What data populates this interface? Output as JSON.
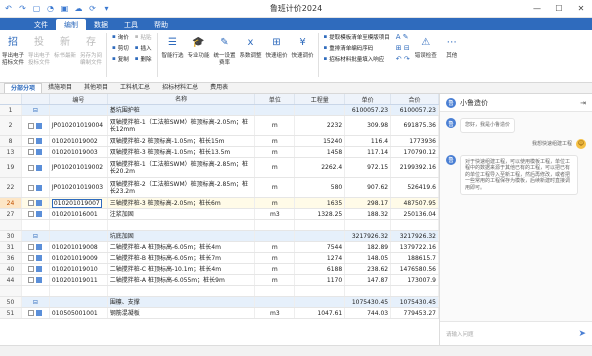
{
  "app": {
    "title": "鲁班计价2024"
  },
  "menu": [
    "文件",
    "编制",
    "数据",
    "工具",
    "帮助"
  ],
  "ribbon": {
    "buttons1": [
      {
        "label": "导出电子招标文件",
        "icon": "招",
        "dim": false
      },
      {
        "label": "导出电子投标文件",
        "icon": "投",
        "dim": true
      },
      {
        "label": "标书最新",
        "icon": "新",
        "dim": true
      },
      {
        "label": "另存为间编制文件",
        "icon": "存",
        "dim": true
      }
    ],
    "small1": [
      {
        "label": "询价",
        "dim": false
      },
      {
        "label": "剪切",
        "dim": false
      },
      {
        "label": "复制",
        "dim": false
      }
    ],
    "small2": [
      {
        "label": "粘贴",
        "dim": true
      },
      {
        "label": "插入",
        "dim": false
      },
      {
        "label": "删除",
        "dim": false
      }
    ],
    "buttons2": [
      {
        "label": "智能行选",
        "icon": "☰"
      },
      {
        "label": "专业功能",
        "icon": "🎓"
      },
      {
        "label": "统一设置费率",
        "icon": "✎"
      },
      {
        "label": "系数调整",
        "icon": "x"
      },
      {
        "label": "快速组价",
        "icon": "⊞"
      },
      {
        "label": "快速调价",
        "icon": "¥"
      }
    ],
    "small3": [
      {
        "label": "提取模板清单至模版项目"
      },
      {
        "label": "重排清单编码序码"
      },
      {
        "label": "招标材料批量填入响应"
      }
    ],
    "buttons3": [
      {
        "label": "错误检查",
        "icon": "⚠"
      },
      {
        "label": "其他",
        "icon": "⋯"
      }
    ]
  },
  "tabs": [
    "分部分项",
    "措施项目",
    "其他项目",
    "工料机汇总",
    "招标材料汇总",
    "费用表"
  ],
  "columns": {
    "code": "编号",
    "name": "名称",
    "unit": "单位",
    "qty": "工程量",
    "price": "单价",
    "total": "合价"
  },
  "rows": [
    {
      "num": "1",
      "code": "",
      "name": "基坑围护桩",
      "unit": "",
      "qty": "",
      "price": "6100057.23",
      "total": "6100057.23",
      "type": "section",
      "h": 11
    },
    {
      "num": "2",
      "code": "JP010201019004",
      "name": "双轴搅拌桩-1（工法桩SWM）桩顶标高-2.05m；桩长12mm",
      "unit": "m",
      "qty": "2232",
      "price": "309.98",
      "total": "691875.36",
      "type": "item",
      "h": 20
    },
    {
      "num": "8",
      "code": "010201019002",
      "name": "双轴搅拌桩-2 桩顶标高-1.05m；桩长15m",
      "unit": "m",
      "qty": "15240",
      "price": "116.4",
      "total": "1773936",
      "type": "item",
      "h": 11
    },
    {
      "num": "13",
      "code": "010201019003",
      "name": "双轴搅拌桩-3 桩顶标高-1.05m；桩长13.5m",
      "unit": "m",
      "qty": "1458",
      "price": "117.14",
      "total": "170790.12",
      "type": "item",
      "h": 11
    },
    {
      "num": "19",
      "code": "JP010201019002",
      "name": "双轴搅拌桩-1（工法桩SWM）桩顶标高-2.85m；桩长20.2m",
      "unit": "m",
      "qty": "2262.4",
      "price": "972.15",
      "total": "2199392.16",
      "type": "item",
      "h": 20
    },
    {
      "num": "22",
      "code": "JP010201019003",
      "name": "双轴搅拌桩-2（工法桩SWM）桩顶标高-2.85m；桩长23.2m",
      "unit": "m",
      "qty": "580",
      "price": "907.62",
      "total": "526419.6",
      "type": "item",
      "h": 20
    },
    {
      "num": "24",
      "code": "010201019007",
      "name": "三轴搅拌桩-3 桩顶标高-2.05m；桩长6m",
      "unit": "m",
      "qty": "1635",
      "price": "298.17",
      "total": "487507.95",
      "type": "sel",
      "h": 11
    },
    {
      "num": "27",
      "code": "010201016001",
      "name": "注浆加固",
      "unit": "m3",
      "qty": "1328.25",
      "price": "188.32",
      "total": "250136.04",
      "type": "item",
      "h": 11
    },
    {
      "num": "",
      "code": "",
      "name": "",
      "unit": "",
      "qty": "",
      "price": "",
      "total": "",
      "type": "blank",
      "h": 11
    },
    {
      "num": "30",
      "code": "",
      "name": "坑底加固",
      "unit": "",
      "qty": "",
      "price": "3217926.32",
      "total": "3217926.32",
      "type": "section",
      "h": 11
    },
    {
      "num": "31",
      "code": "010201019008",
      "name": "二轴搅拌桩-A 桩顶标高-6.05m；桩长4m",
      "unit": "m",
      "qty": "7544",
      "price": "182.89",
      "total": "1379722.16",
      "type": "item",
      "h": 11
    },
    {
      "num": "36",
      "code": "010201019009",
      "name": "二轴搅拌桩-B 桩顶标高-6.05m；桩长7m",
      "unit": "m",
      "qty": "1274",
      "price": "148.05",
      "total": "188615.7",
      "type": "item",
      "h": 11
    },
    {
      "num": "40",
      "code": "010201019010",
      "name": "二轴搅拌桩-C 桩顶标高-10.1m；桩长4m",
      "unit": "m",
      "qty": "6188",
      "price": "238.62",
      "total": "1476580.56",
      "type": "item",
      "h": 11
    },
    {
      "num": "44",
      "code": "010201019011",
      "name": "二轴搅拌桩-A 桩顶标高-6.055m；桩长9m",
      "unit": "m",
      "qty": "1170",
      "price": "147.87",
      "total": "173007.9",
      "type": "item",
      "h": 11
    },
    {
      "num": "",
      "code": "",
      "name": "",
      "unit": "",
      "qty": "",
      "price": "",
      "total": "",
      "type": "blank",
      "h": 11
    },
    {
      "num": "50",
      "code": "",
      "name": "围檩、支撑",
      "unit": "",
      "qty": "",
      "price": "1075430.45",
      "total": "1075430.45",
      "type": "section",
      "h": 11
    },
    {
      "num": "51",
      "code": "010505001001",
      "name": "钢筋混凝板",
      "unit": "m3",
      "qty": "1047.61",
      "price": "744.03",
      "total": "779453.27",
      "type": "item",
      "h": 11
    }
  ],
  "assistant": {
    "title": "小鲁造价",
    "greeting": "您好，我是小鲁造价",
    "user_msg": "我想快速组建工程",
    "reply": "对于快速组建工程，可以使用模板工程，单位工程中的数据来源于其他已有的工程，可以把已有的单位工程导入至新工程，然后再修改，或者把一些常用的工程保存为模板，后续新建时直接调用即可。",
    "input_placeholder": "请输入问题"
  }
}
